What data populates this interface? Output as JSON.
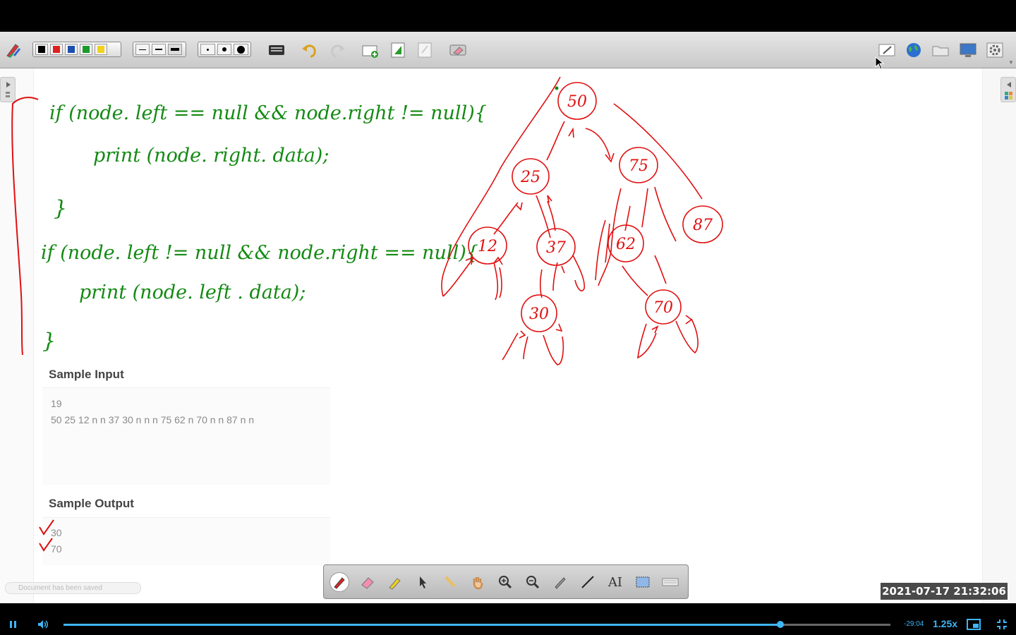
{
  "toolbar": {
    "colors": [
      "#000000",
      "#e02020",
      "#1a4fb0",
      "#1a9a2a",
      "#f1d21c"
    ],
    "line_widths": [
      "thin",
      "medium",
      "thick"
    ],
    "dot_sizes": [
      "small",
      "medium",
      "large"
    ],
    "icons": [
      "pen-settings-icon",
      "keyboard-icon",
      "undo-icon",
      "redo-icon",
      "new-page-icon",
      "next-page-icon",
      "blank-page-icon",
      "eraser-clear-icon",
      "edit-icon",
      "globe-icon",
      "folder-icon",
      "display-icon",
      "settings-icon"
    ]
  },
  "board": {
    "code_color": "#138a13",
    "tree_color": "#e01010",
    "code_lines": [
      "if (node. left == null && node.right != null){",
      "print (node. right. data);",
      "}",
      "if (node. left != null && node.right == null){",
      "print (node. left . data);",
      "}"
    ],
    "tree_nodes": [
      "50",
      "25",
      "75",
      "12",
      "37",
      "62",
      "87",
      "30",
      "70"
    ]
  },
  "sample_input": {
    "title": "Sample Input",
    "lines": [
      "19",
      "50 25 12 n n 37 30 n n n 75 62 n 70 n n 87 n n"
    ]
  },
  "sample_output": {
    "title": "Sample Output",
    "lines": [
      "30",
      "70"
    ]
  },
  "palette": {
    "tools": [
      "pen-icon",
      "eraser-icon",
      "highlighter-icon",
      "pointer-icon",
      "laser-pointer-icon",
      "hand-icon",
      "zoom-in-icon",
      "zoom-out-icon",
      "brush-icon",
      "line-icon",
      "text-icon",
      "screen-capture-icon",
      "keyboard-icon"
    ],
    "text_tool_label": "AI"
  },
  "status": {
    "timestamp": "2021-07-17  21:32:06",
    "saved_toast": "Document has been saved"
  },
  "player": {
    "progress_fraction": 0.867,
    "time_remaining": "-29:04",
    "speed": "1.25x",
    "accent": "#3fb6f5"
  }
}
